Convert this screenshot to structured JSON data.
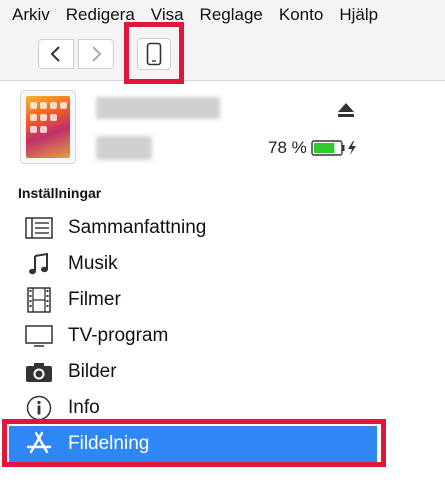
{
  "menu": [
    "Arkiv",
    "Redigera",
    "Visa",
    "Reglage",
    "Konto",
    "Hjälp"
  ],
  "toolbar": {
    "back_icon": "chevron-left-icon",
    "forward_icon": "chevron-right-icon",
    "device_icon": "phone-icon"
  },
  "device": {
    "battery_percent_text": "78 %",
    "battery_level": 0.78,
    "battery_color": "#2ecc2e",
    "charging": true
  },
  "settings": {
    "title": "Inställningar",
    "items": [
      {
        "label": "Sammanfattning",
        "icon": "summary-list-icon"
      },
      {
        "label": "Musik",
        "icon": "music-note-icon"
      },
      {
        "label": "Filmer",
        "icon": "film-icon"
      },
      {
        "label": "TV-program",
        "icon": "tv-icon"
      },
      {
        "label": "Bilder",
        "icon": "camera-icon"
      },
      {
        "label": "Info",
        "icon": "info-icon"
      },
      {
        "label": "Fildelning",
        "icon": "app-store-icon",
        "selected": true
      }
    ]
  },
  "colors": {
    "selection": "#2f86f5",
    "annotation": "#e0173a"
  }
}
